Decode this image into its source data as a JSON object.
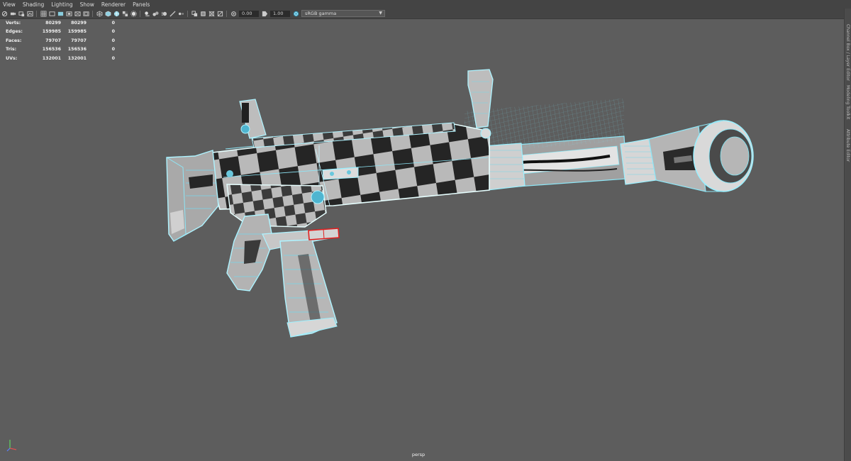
{
  "menubar": {
    "items": [
      "View",
      "Shading",
      "Lighting",
      "Show",
      "Renderer",
      "Panels"
    ]
  },
  "toolbar": {
    "icon_names": [
      "select-camera-icon",
      "camera-attributes-icon",
      "bookmark-icon",
      "image-plane-icon",
      "grid-icon",
      "film-gate-icon",
      "resolution-gate-icon",
      "gate-mask-icon",
      "field-chart-icon",
      "safe-action-icon",
      "wireframe-icon",
      "smooth-shade-icon",
      "wireframe-on-shaded-icon",
      "textured-icon",
      "use-lights-icon",
      "shadows-icon",
      "ambient-occlusion-icon",
      "motion-blur-icon",
      "anti-aliasing-icon",
      "depth-of-field-icon",
      "isolate-select-icon",
      "xray-icon",
      "xray-joints-icon",
      "backface-culling-icon",
      "exposure-icon",
      "gamma-icon",
      "color-management-icon"
    ],
    "exposure_value": "0.00",
    "gamma_value": "1.00",
    "view_transform": "sRGB gamma"
  },
  "hud": {
    "rows": [
      {
        "label": "Verts:",
        "v1": "80299",
        "v2": "80299",
        "v3": "0"
      },
      {
        "label": "Edges:",
        "v1": "159985",
        "v2": "159985",
        "v3": "0"
      },
      {
        "label": "Faces:",
        "v1": "79707",
        "v2": "79707",
        "v3": "0"
      },
      {
        "label": "Tris:",
        "v1": "156536",
        "v2": "156536",
        "v3": "0"
      },
      {
        "label": "UVs:",
        "v1": "132001",
        "v2": "132001",
        "v3": "0"
      }
    ]
  },
  "viewport": {
    "camera": "persp",
    "colors": {
      "background": "#5d5d5d",
      "wire": "#7fe6f5",
      "wire_highlight": "#e7ffff",
      "checker_dark": "#252525",
      "checker_light": "#b9b9b9",
      "selected_edge": "#e02020"
    }
  },
  "side_tabs": {
    "items": [
      "Channel Box / Layer Editor",
      "Modeling Toolkit",
      "Attribute Editor"
    ]
  }
}
